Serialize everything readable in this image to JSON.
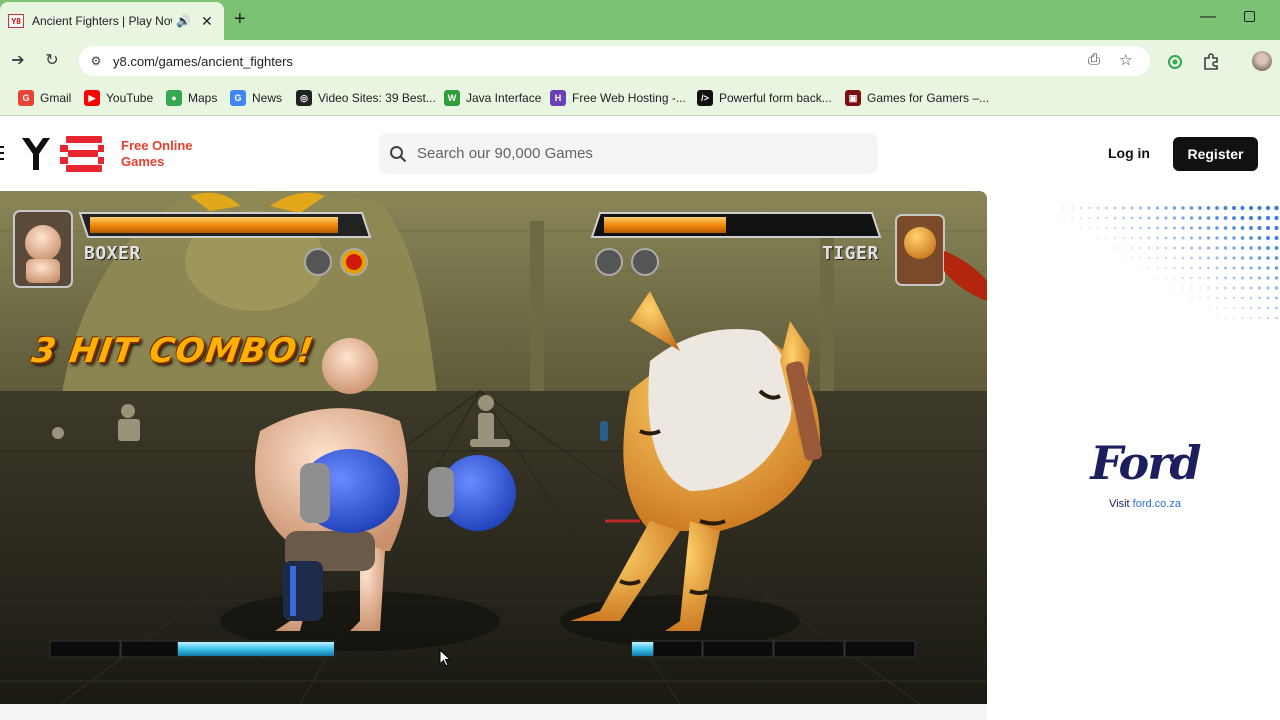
{
  "browser": {
    "tab": {
      "favicon_text": "Y8",
      "title": "Ancient Fighters | Play Now"
    },
    "url": "y8.com/games/ancient_fighters",
    "bookmarks": [
      {
        "label": "Gmail",
        "color": "#ea4335",
        "glyph": "G"
      },
      {
        "label": "YouTube",
        "color": "#ff0000",
        "glyph": "▶"
      },
      {
        "label": "Maps",
        "color": "#34a853",
        "glyph": "●"
      },
      {
        "label": "News",
        "color": "#4285f4",
        "glyph": "G"
      },
      {
        "label": "Video Sites: 39 Best...",
        "color": "#202124",
        "glyph": "◎"
      },
      {
        "label": "Java Interface",
        "color": "#2e9d3a",
        "glyph": "W"
      },
      {
        "label": "Free Web Hosting -...",
        "color": "#6b3fb8",
        "glyph": "H"
      },
      {
        "label": "Powerful form back...",
        "color": "#111111",
        "glyph": "/>"
      },
      {
        "label": "Games for Gamers –...",
        "color": "#7a1010",
        "glyph": "▣"
      }
    ]
  },
  "site": {
    "logo_text_line1": "Free Online",
    "logo_text_line2": "Games",
    "search_placeholder": "Search our 90,000 Games",
    "login_label": "Log in",
    "register_label": "Register"
  },
  "game": {
    "player1": {
      "name": "BOXER",
      "health": 0.92,
      "power_segments": 4,
      "power_filled": 2.2
    },
    "player2": {
      "name": "TIGER",
      "health": 0.45,
      "power_segments": 4,
      "power_filled": 0.3
    },
    "combo_text": "3 HIT COMBO!"
  },
  "ad": {
    "brand": "Ford",
    "visit_prefix": "Visit ",
    "visit_link": "ford.co.za"
  }
}
